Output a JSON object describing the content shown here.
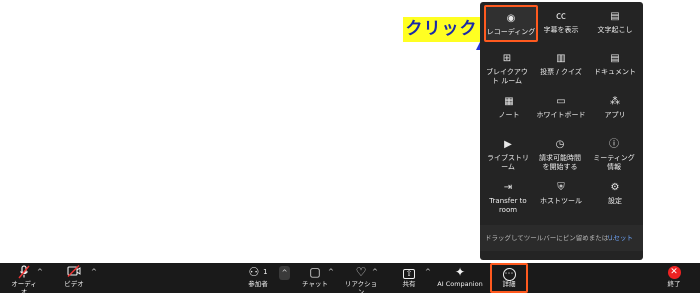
{
  "annotation": {
    "label": "クリック"
  },
  "more_menu": {
    "items": [
      {
        "label": "レコーディング",
        "icon": "record-icon",
        "glyph": "◉"
      },
      {
        "label": "字幕を表示",
        "icon": "cc-icon",
        "glyph": "㏄"
      },
      {
        "label": "文字起こし",
        "icon": "transcript-icon",
        "glyph": "▤"
      },
      {
        "label": "ブレイクアウト ルーム",
        "icon": "breakout-rooms-icon",
        "glyph": "⊞"
      },
      {
        "label": "投票 / クイズ",
        "icon": "polls-icon",
        "glyph": "▥"
      },
      {
        "label": "ドキュメント",
        "icon": "document-icon",
        "glyph": "▤"
      },
      {
        "label": "ノート",
        "icon": "notes-icon",
        "glyph": "▦"
      },
      {
        "label": "ホワイトボード",
        "icon": "whiteboard-icon",
        "glyph": "▭"
      },
      {
        "label": "アプリ",
        "icon": "apps-icon",
        "glyph": "⁂"
      },
      {
        "label": "ライブストリーム",
        "icon": "livestream-icon",
        "glyph": "▶"
      },
      {
        "label": "請求可能時間を開始する",
        "icon": "billable-time-icon",
        "glyph": "◷"
      },
      {
        "label": "ミーティング情報",
        "icon": "info-icon",
        "glyph": "ⓘ"
      },
      {
        "label": "Transfer to room",
        "icon": "transfer-icon",
        "glyph": "⇥"
      },
      {
        "label": "ホストツール",
        "icon": "shield-icon",
        "glyph": "⛨"
      },
      {
        "label": "設定",
        "icon": "settings-icon",
        "glyph": "⚙"
      }
    ],
    "footer": {
      "text": "ドラッグしてツールバーにピン留めまたは...",
      "reset": "リセット"
    }
  },
  "toolbar": {
    "audio": {
      "label": "オーディオ",
      "icon": "mic-muted-icon",
      "glyph": "🎙"
    },
    "video": {
      "label": "ビデオ",
      "icon": "video-off-icon",
      "glyph": "▣"
    },
    "participants": {
      "label": "参加者",
      "count": "1",
      "icon": "participants-icon",
      "glyph": "⚇"
    },
    "chat": {
      "label": "チャット",
      "icon": "chat-icon",
      "glyph": "▢"
    },
    "reactions": {
      "label": "リアクション",
      "icon": "heart-icon",
      "glyph": "♡"
    },
    "share": {
      "label": "共有",
      "icon": "share-icon",
      "glyph": "⇧"
    },
    "ai": {
      "label": "AI Companion",
      "icon": "sparkle-icon",
      "glyph": "✦"
    },
    "more": {
      "label": "詳細",
      "icon": "more-icon",
      "glyph": "⋯"
    },
    "end": {
      "label": "終了",
      "icon": "end-icon",
      "glyph": "✕"
    },
    "caret": "^",
    "caret_up": "⌃"
  },
  "colors": {
    "highlight": "#ff5a1f",
    "label_bg": "#ffff22",
    "label_text": "#1a2aa8",
    "panel_bg": "#242424"
  }
}
